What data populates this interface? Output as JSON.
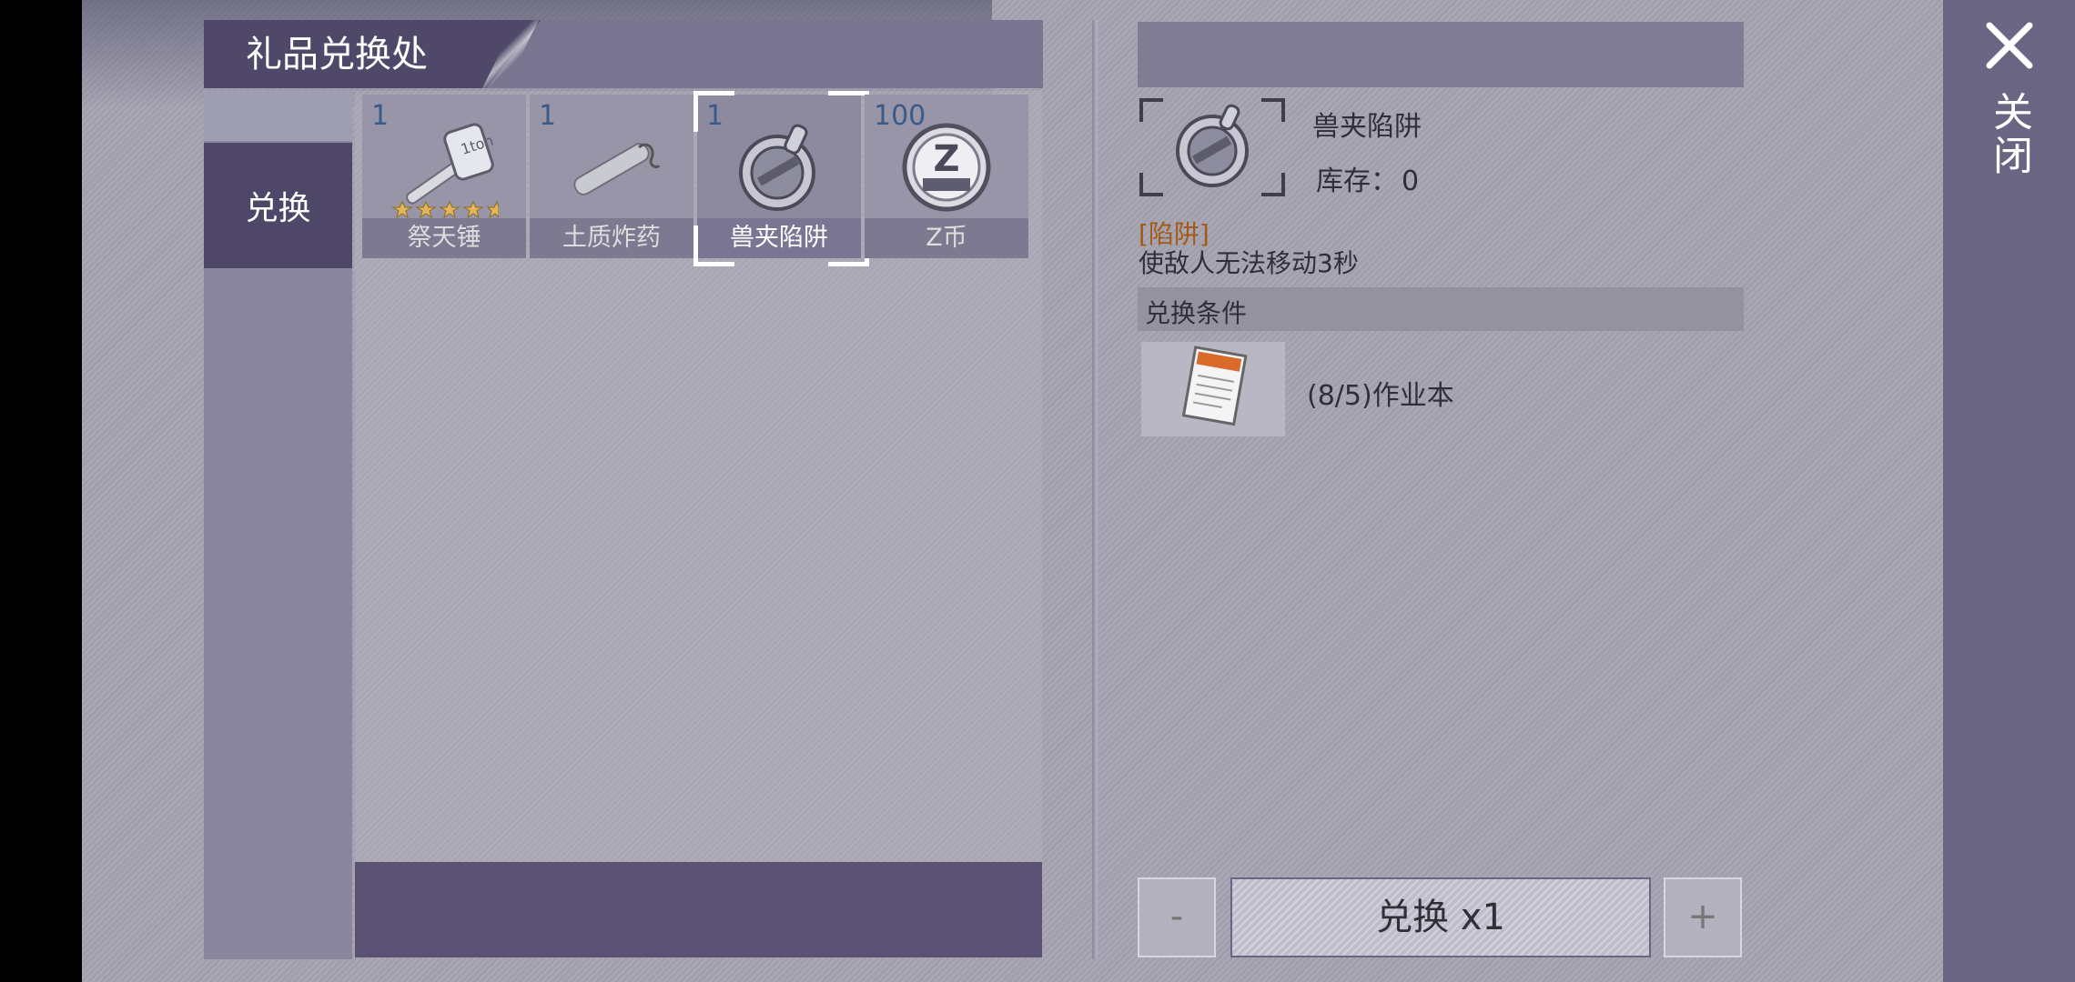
{
  "title": "礼品兑换处",
  "close_label": "关闭",
  "tabs": [
    {
      "label": "兑换",
      "active": true
    }
  ],
  "items": [
    {
      "count": "1",
      "name": "祭天锤",
      "icon": "hammer-icon"
    },
    {
      "count": "1",
      "name": "土质炸药",
      "icon": "dynamite-icon"
    },
    {
      "count": "1",
      "name": "兽夹陷阱",
      "icon": "bear-trap-icon",
      "selected": true
    },
    {
      "count": "100",
      "name": "Z币",
      "icon": "z-coin-icon"
    }
  ],
  "detail": {
    "name": "兽夹陷阱",
    "stock_label": "库存：",
    "stock_value": "0",
    "category": "[陷阱]",
    "description": "使敌人无法移动3秒",
    "condition_title": "兑换条件",
    "condition_text": "(8/5)作业本",
    "condition_icon": "notebook-icon"
  },
  "actions": {
    "minus": "-",
    "exchange": "兑换 x1",
    "plus": "+"
  },
  "colors": {
    "accent": "#4e4767",
    "category": "#a45a14",
    "count": "#3a5a8a"
  }
}
